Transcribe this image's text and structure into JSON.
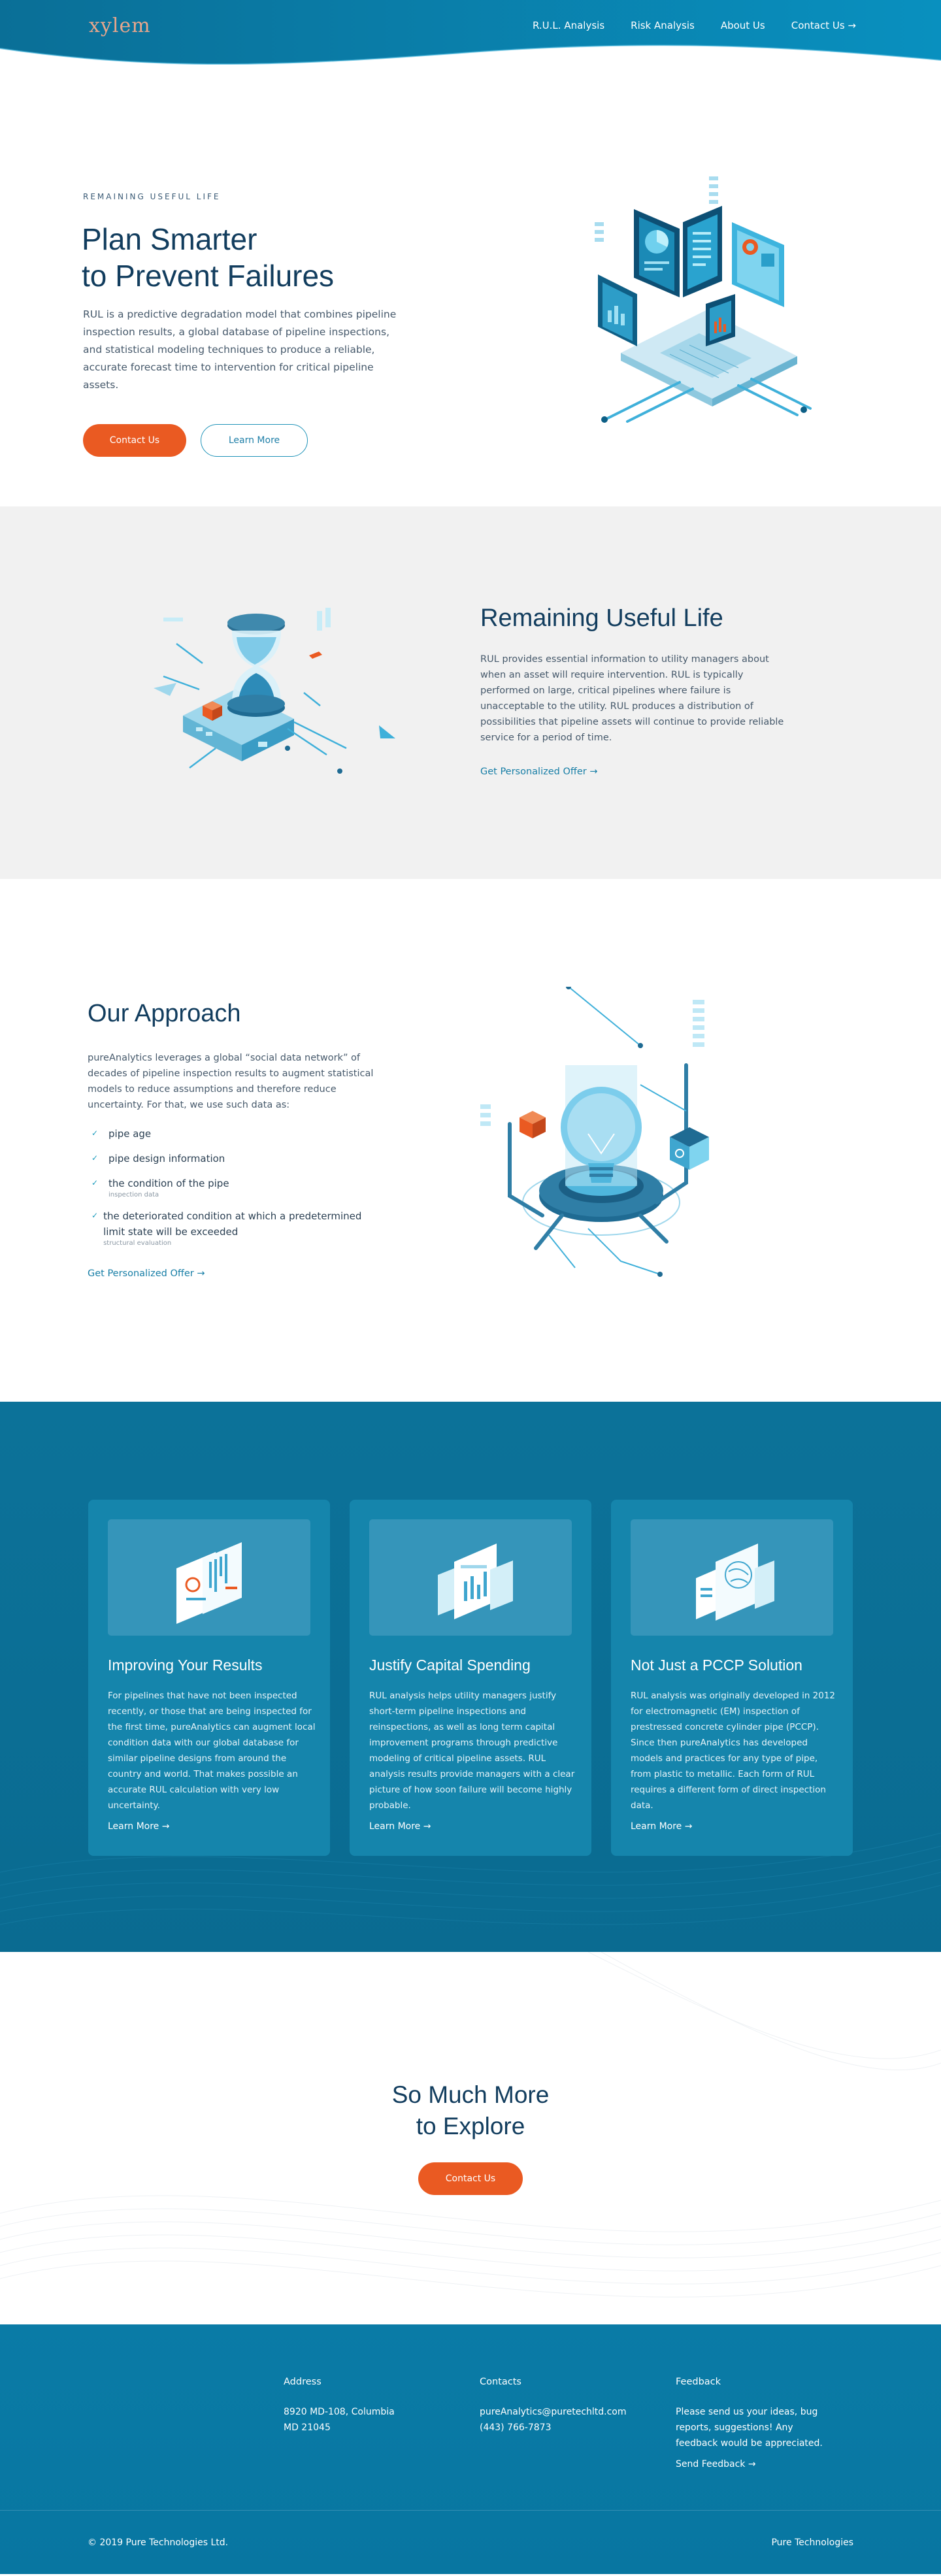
{
  "header": {
    "logo": "xylem",
    "nav": [
      "R.U.L. Analysis",
      "Risk Analysis",
      "About Us",
      "Contact Us →"
    ]
  },
  "hero": {
    "eyebrow": "REMAINING USEFUL LIFE",
    "title_line1": "Plan Smarter",
    "title_line2": "to Prevent Failures",
    "description": "RUL is a predictive degradation model that combines pipeline inspection results, a global database of pipeline inspections, and statistical modeling techniques to produce a reliable, accurate forecast time to intervention for critical pipeline assets.",
    "primary_button": "Contact Us",
    "secondary_button": "Learn More"
  },
  "rul": {
    "title": "Remaining Useful Life",
    "description": "RUL provides essential information to utility managers about when an asset will require intervention. RUL is typically performed on large, critical pipelines where failure is unacceptable to the utility. RUL produces a distribution of possibilities that pipeline assets will continue to provide reliable service for a period of time.",
    "link": "Get Personalized Offer →"
  },
  "approach": {
    "title": "Our Approach",
    "description": "pureAnalytics leverages a global “social data network” of decades of pipeline inspection results to augment statistical models to reduce assumptions and therefore reduce uncertainty. For that, we use such data as:",
    "items": [
      {
        "text": "pipe age",
        "note": ""
      },
      {
        "text": "pipe design information",
        "note": ""
      },
      {
        "text": "the condition of the pipe",
        "note": "inspection data"
      },
      {
        "text": "the deteriorated condition at which a predetermined limit state will be exceeded",
        "note": "structural evaluation"
      }
    ],
    "link": "Get Personalized Offer →"
  },
  "features": {
    "cards": [
      {
        "title": "Improving Your Results",
        "text": "For pipelines that have not been inspected recently, or those that are being inspected for the first time, pureAnalytics can augment local condition data with our global database for similar pipeline designs from around the country and world. That makes possible an accurate RUL calculation with very low uncertainty.",
        "link": "Learn More →"
      },
      {
        "title": "Justify Capital Spending",
        "text": "RUL analysis helps utility managers justify short-term pipeline inspections and reinspections, as well as long term capital improvement programs through predictive modeling of critical pipeline assets. RUL analysis results provide managers with a clear picture of how soon failure will become highly probable.",
        "link": "Learn More →"
      },
      {
        "title": "Not Just a PCCP Solution",
        "text": "RUL analysis was originally developed in 2012 for electromagnetic (EM) inspection of prestressed concrete cylinder pipe (PCCP). Since then pureAnalytics has developed models and practices for any type of pipe, from plastic to metallic. Each form of RUL requires a different form of direct inspection data.",
        "link": "Learn More →"
      }
    ]
  },
  "explore": {
    "title_line1": "So Much More",
    "title_line2": "to Explore",
    "button": "Contact Us"
  },
  "footer": {
    "address_heading": "Address",
    "address_line1": "8920 MD-108, Columbia",
    "address_line2": "MD 21045",
    "contacts_heading": "Contacts",
    "email": "pureAnalytics@puretechltd.com",
    "phone": "(443) 766-7873",
    "feedback_heading": "Feedback",
    "feedback_text": "Please send us your ideas, bug reports, suggestions! Any feedback would be appreciated.",
    "feedback_link": "Send Feedback →",
    "copyright": "© 2019 Pure Technologies Ltd.",
    "brand": "Pure Technologies"
  },
  "colors": {
    "accent_orange": "#ea5a22",
    "primary_blue": "#0c7299",
    "heading_navy": "#123d5e",
    "link_teal": "#177ea6"
  }
}
